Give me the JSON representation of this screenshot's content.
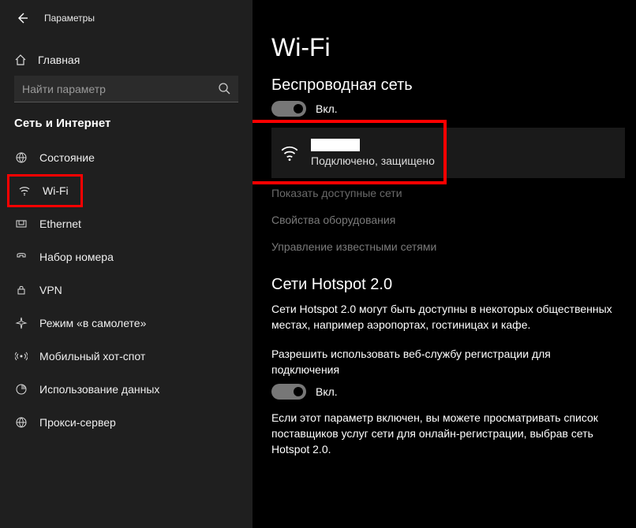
{
  "titlebar": {
    "title": "Параметры"
  },
  "sidebar": {
    "home": "Главная",
    "search_placeholder": "Найти параметр",
    "section": "Сеть и Интернет",
    "items": [
      {
        "label": "Состояние"
      },
      {
        "label": "Wi-Fi"
      },
      {
        "label": "Ethernet"
      },
      {
        "label": "Набор номера"
      },
      {
        "label": "VPN"
      },
      {
        "label": "Режим «в самолете»"
      },
      {
        "label": "Мобильный хот-спот"
      },
      {
        "label": "Использование данных"
      },
      {
        "label": "Прокси-сервер"
      }
    ]
  },
  "main": {
    "title": "Wi-Fi",
    "wireless_heading": "Беспроводная сеть",
    "wireless_toggle_label": "Вкл.",
    "connection_status": "Подключено, защищено",
    "links": {
      "show_networks": "Показать доступные сети",
      "hw_props": "Свойства оборудования",
      "manage_known": "Управление известными сетями"
    },
    "hotspot_heading": "Сети Hotspot 2.0",
    "hotspot_desc": "Сети Hotspot 2.0 могут быть доступны в некоторых общественных местах, например аэропортах, гостиницах и кафе.",
    "hotspot_allow": "Разрешить использовать веб-службу регистрации для подключения",
    "hotspot_toggle_label": "Вкл.",
    "hotspot_note": "Если этот параметр включен, вы можете просматривать список поставщиков услуг сети для онлайн-регистрации, выбрав сеть Hotspot 2.0."
  }
}
